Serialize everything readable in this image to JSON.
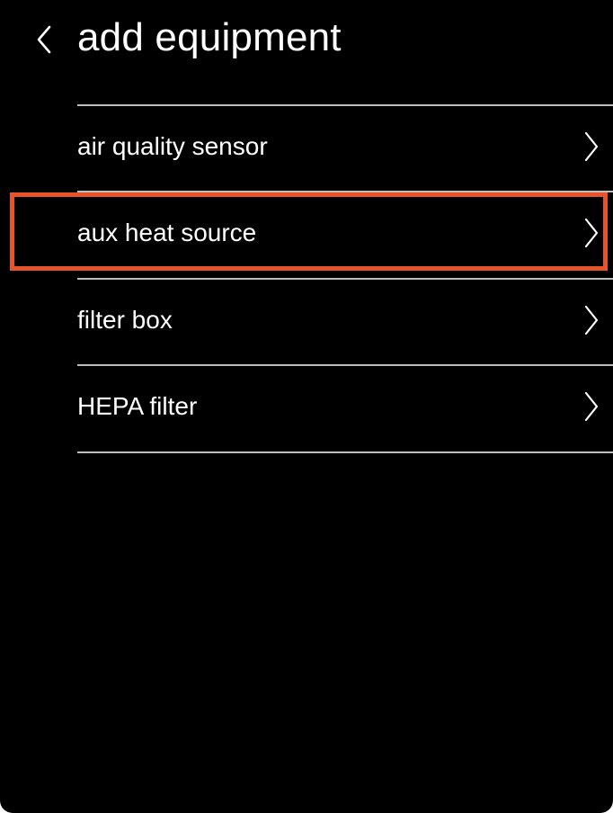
{
  "header": {
    "back_icon": "chevron-left-icon",
    "title": "add equipment"
  },
  "equipment_list": {
    "items": [
      {
        "label": "air quality sensor",
        "icon": "chevron-right-icon"
      },
      {
        "label": "aux heat source",
        "icon": "chevron-right-icon",
        "highlighted": true
      },
      {
        "label": "filter box",
        "icon": "chevron-right-icon"
      },
      {
        "label": "HEPA filter",
        "icon": "chevron-right-icon"
      }
    ]
  },
  "colors": {
    "background": "#000000",
    "text": "#ffffff",
    "divider": "#bdbdbd",
    "highlight": "#e8542a"
  }
}
